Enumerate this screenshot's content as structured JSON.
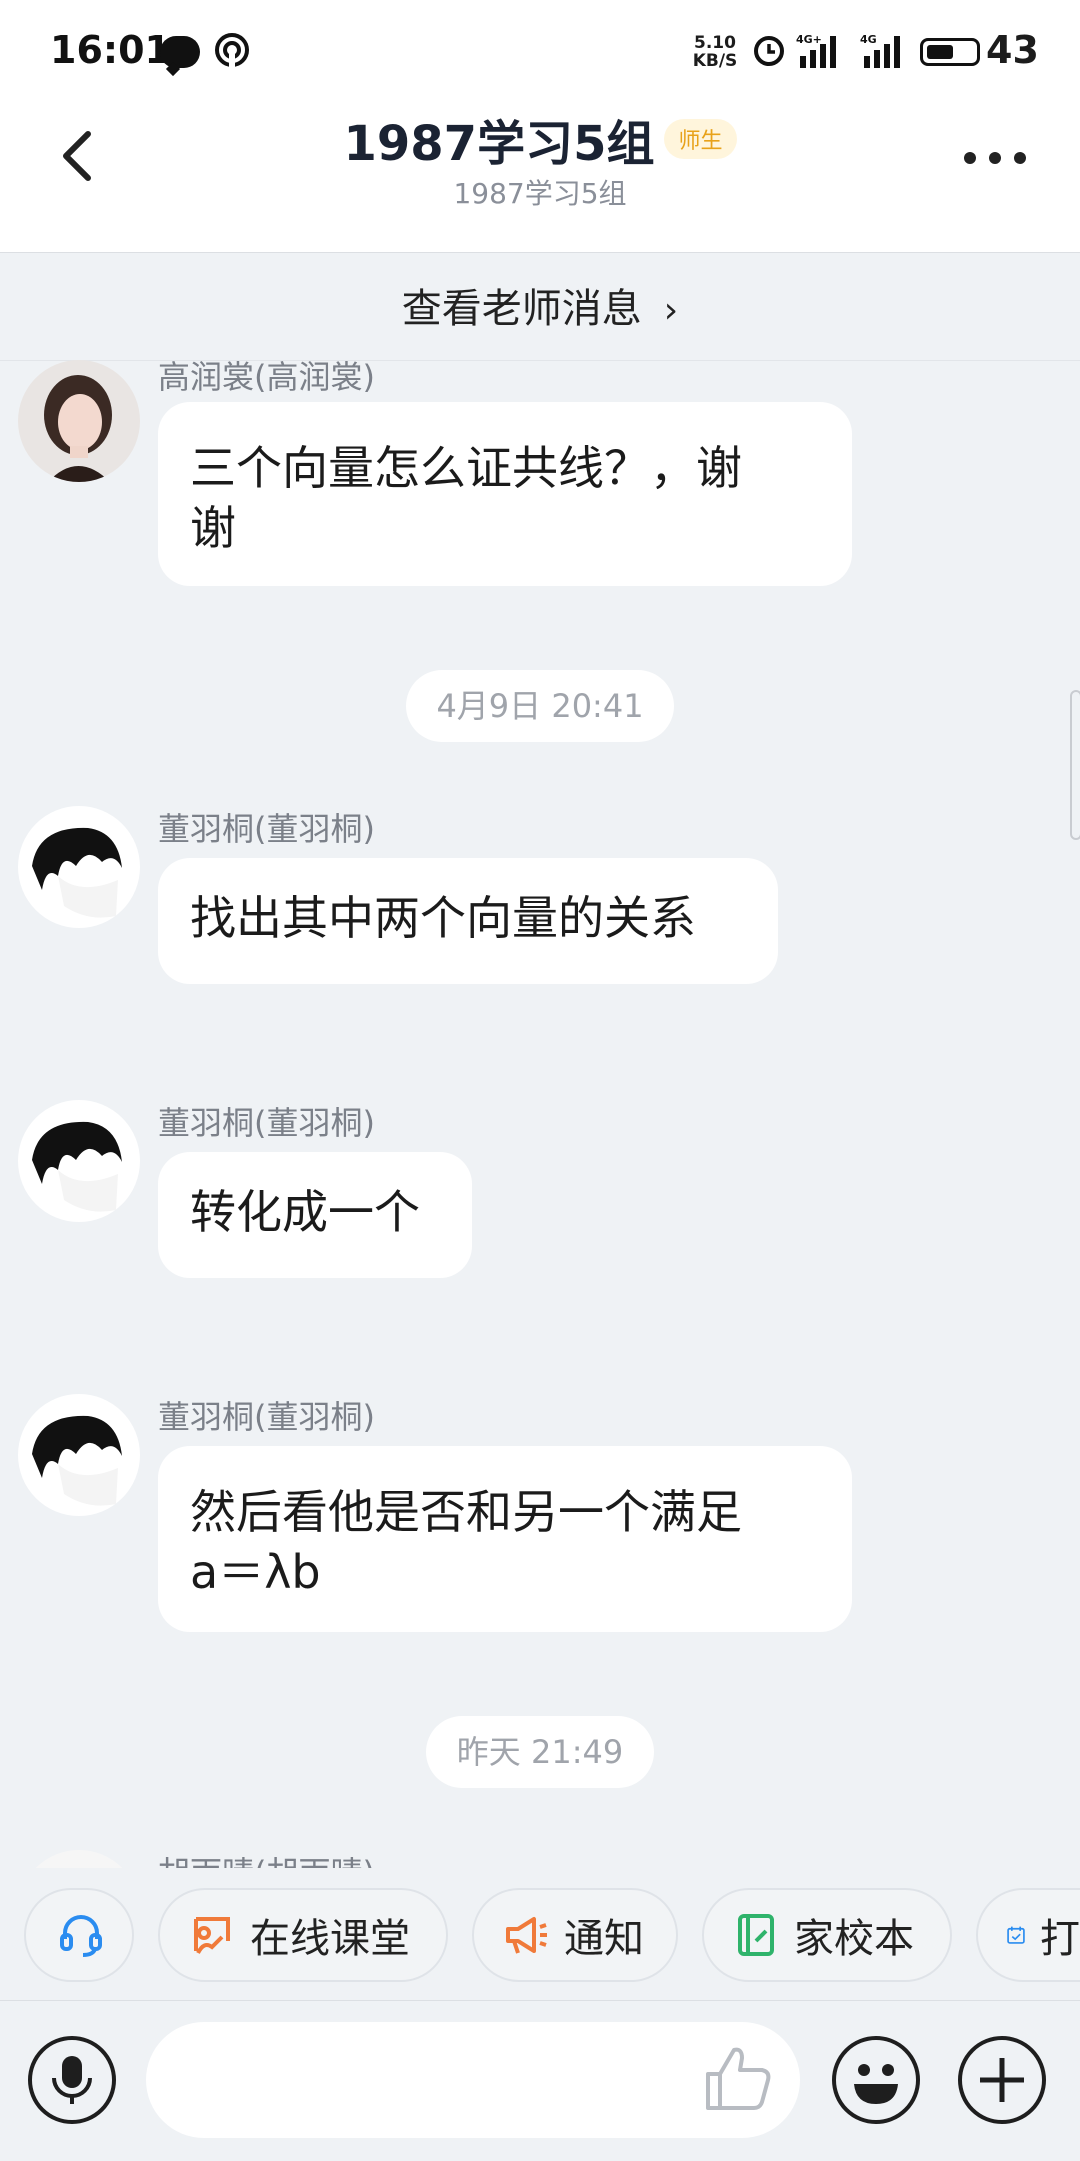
{
  "status": {
    "time": "16:01",
    "speed_top": "5.10",
    "speed_unit": "KB/S",
    "net1": "4G+",
    "net2": "4G",
    "battery": "43"
  },
  "header": {
    "title": "1987学习5组",
    "badge": "师生",
    "subtitle": "1987学习5组"
  },
  "teacher_bar": {
    "label": "查看老师消息",
    "arrow": "›"
  },
  "messages": [
    {
      "sender": "高润裳(高润裳)",
      "lines": [
        "三个向量怎么证共线？，谢",
        "谢"
      ]
    },
    {
      "sender": "董羽桐(董羽桐)",
      "lines": [
        "找出其中两个向量的关系"
      ]
    },
    {
      "sender": "董羽桐(董羽桐)",
      "lines": [
        "转化成一个"
      ]
    },
    {
      "sender": "董羽桐(董羽桐)",
      "lines": [
        "然后看他是否和另一个满足",
        "a＝λb"
      ]
    },
    {
      "sender": "胡雨晴(胡雨晴)",
      "lines": []
    }
  ],
  "timestamps": [
    "4月9日 20:41",
    "昨天 21:49"
  ],
  "quick_actions": [
    {
      "label": "",
      "icon": "headset-icon"
    },
    {
      "label": "在线课堂",
      "icon": "online-class-icon"
    },
    {
      "label": "通知",
      "icon": "megaphone-icon"
    },
    {
      "label": "家校本",
      "icon": "notebook-icon"
    },
    {
      "label": "打",
      "icon": "calendar-check-icon"
    }
  ],
  "input": {
    "placeholder": ""
  },
  "colors": {
    "background": "#eff2f5",
    "bubble": "#ffffff",
    "badge_text": "#e8a21a",
    "icon_blue": "#2a8cf0",
    "icon_orange": "#f07a3a",
    "icon_green": "#2fb36b"
  }
}
